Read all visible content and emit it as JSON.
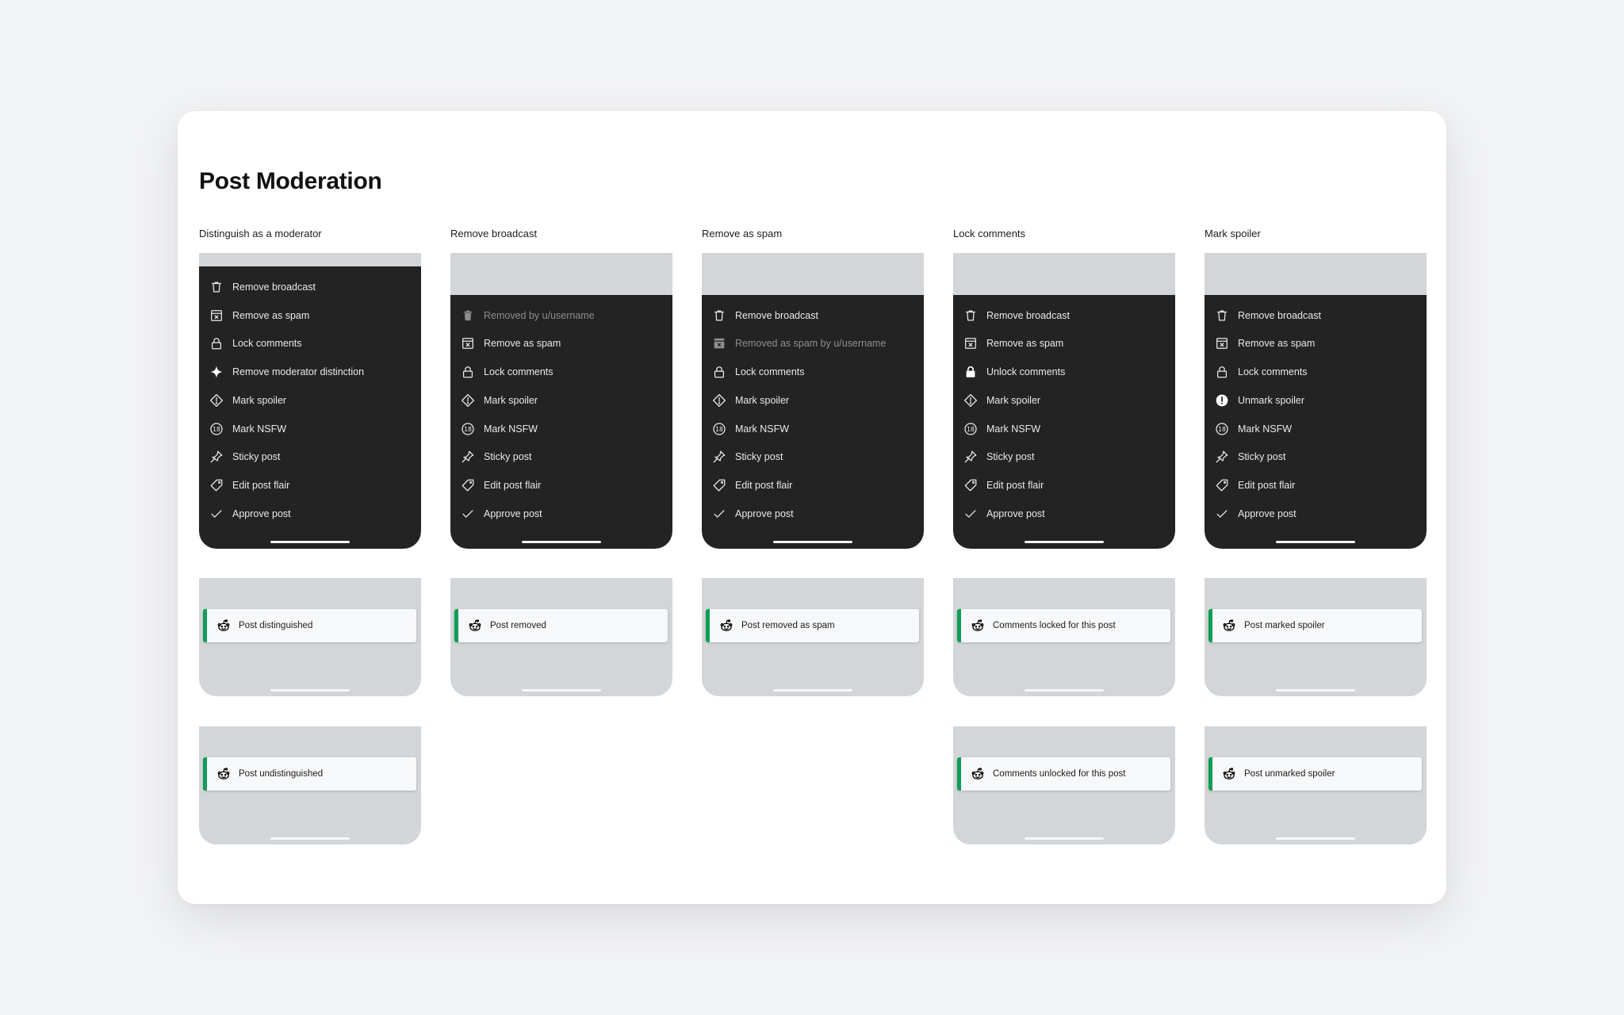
{
  "page_title": "Post Moderation",
  "columns": [
    {
      "label": "Distinguish as a moderator",
      "menu": [
        {
          "icon": "trash-icon",
          "label": "Remove broadcast"
        },
        {
          "icon": "spam-icon",
          "label": "Remove as spam"
        },
        {
          "icon": "lock-icon",
          "label": "Lock comments"
        },
        {
          "icon": "sparkle-filled-icon",
          "label": "Remove moderator distinction"
        },
        {
          "icon": "spoiler-icon",
          "label": "Mark spoiler"
        },
        {
          "icon": "nsfw-icon",
          "label": "Mark NSFW"
        },
        {
          "icon": "pin-icon",
          "label": "Sticky post"
        },
        {
          "icon": "tag-icon",
          "label": "Edit post flair"
        },
        {
          "icon": "check-icon",
          "label": "Approve post"
        }
      ],
      "toasts": [
        {
          "icon": "reddit-snoo-icon",
          "text": "Post distinguished"
        },
        {
          "icon": "reddit-snoo-icon",
          "text": "Post undistinguished"
        }
      ]
    },
    {
      "label": "Remove broadcast",
      "menu": [
        {
          "icon": "trash-filled-icon",
          "label": "Removed by u/username",
          "dimmed": true
        },
        {
          "icon": "spam-icon",
          "label": "Remove as spam"
        },
        {
          "icon": "lock-icon",
          "label": "Lock comments"
        },
        {
          "icon": "spoiler-icon",
          "label": "Mark spoiler"
        },
        {
          "icon": "nsfw-icon",
          "label": "Mark NSFW"
        },
        {
          "icon": "pin-icon",
          "label": "Sticky post"
        },
        {
          "icon": "tag-icon",
          "label": "Edit post flair"
        },
        {
          "icon": "check-icon",
          "label": "Approve post"
        }
      ],
      "toasts": [
        {
          "icon": "reddit-snoo-icon",
          "text": "Post removed"
        }
      ]
    },
    {
      "label": "Remove as spam",
      "menu": [
        {
          "icon": "trash-icon",
          "label": "Remove broadcast"
        },
        {
          "icon": "spam-filled-icon",
          "label": "Removed as spam by u/username",
          "dimmed": true
        },
        {
          "icon": "lock-icon",
          "label": "Lock comments"
        },
        {
          "icon": "spoiler-icon",
          "label": "Mark spoiler"
        },
        {
          "icon": "nsfw-icon",
          "label": "Mark NSFW"
        },
        {
          "icon": "pin-icon",
          "label": "Sticky post"
        },
        {
          "icon": "tag-icon",
          "label": "Edit post flair"
        },
        {
          "icon": "check-icon",
          "label": "Approve post"
        }
      ],
      "toasts": [
        {
          "icon": "reddit-snoo-icon",
          "text": "Post removed as spam"
        }
      ]
    },
    {
      "label": "Lock comments",
      "menu": [
        {
          "icon": "trash-icon",
          "label": "Remove broadcast"
        },
        {
          "icon": "spam-icon",
          "label": "Remove as spam"
        },
        {
          "icon": "lock-filled-icon",
          "label": "Unlock comments"
        },
        {
          "icon": "spoiler-icon",
          "label": "Mark spoiler"
        },
        {
          "icon": "nsfw-icon",
          "label": "Mark NSFW"
        },
        {
          "icon": "pin-icon",
          "label": "Sticky post"
        },
        {
          "icon": "tag-icon",
          "label": "Edit post flair"
        },
        {
          "icon": "check-icon",
          "label": "Approve post"
        }
      ],
      "toasts": [
        {
          "icon": "reddit-snoo-icon",
          "text": "Comments locked for this post"
        },
        {
          "icon": "reddit-snoo-icon",
          "text": "Comments unlocked for this post"
        }
      ]
    },
    {
      "label": "Mark spoiler",
      "menu": [
        {
          "icon": "trash-icon",
          "label": "Remove broadcast"
        },
        {
          "icon": "spam-icon",
          "label": "Remove as spam"
        },
        {
          "icon": "lock-icon",
          "label": "Lock comments"
        },
        {
          "icon": "spoiler-filled-icon",
          "label": "Unmark spoiler"
        },
        {
          "icon": "nsfw-icon",
          "label": "Mark NSFW"
        },
        {
          "icon": "pin-icon",
          "label": "Sticky post"
        },
        {
          "icon": "tag-icon",
          "label": "Edit post flair"
        },
        {
          "icon": "check-icon",
          "label": "Approve post"
        }
      ],
      "toasts": [
        {
          "icon": "reddit-snoo-icon",
          "text": "Post marked spoiler"
        },
        {
          "icon": "reddit-snoo-icon",
          "text": "Post unmarked spoiler"
        }
      ]
    }
  ],
  "colors": {
    "menu_background": "#232323",
    "placeholder_gray": "#d3d6d8",
    "toast_success_bar": "#0f9d58",
    "card_background": "#ffffff",
    "page_background": "#f2f3f5"
  }
}
